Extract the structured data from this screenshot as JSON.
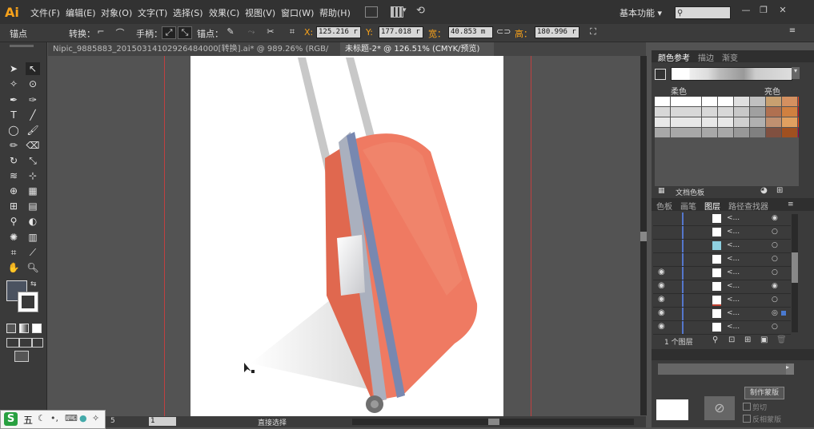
{
  "app": {
    "logo": "Ai"
  },
  "menu": [
    "文件(F)",
    "编辑(E)",
    "对象(O)",
    "文字(T)",
    "选择(S)",
    "效果(C)",
    "视图(V)",
    "窗口(W)",
    "帮助(H)"
  ],
  "workspace": {
    "label": "基本功能",
    "arrow": "▾"
  },
  "window_buttons": [
    "—",
    "❐",
    "✕"
  ],
  "control": {
    "anchor_label": "锚点",
    "convert_label": "转换：",
    "handle_label": "手柄：",
    "anchor2_label": "锚点：",
    "x_label": "X:",
    "x_value": "125.216 r",
    "y_label": "Y:",
    "y_value": "177.018 r",
    "w_label": "宽：",
    "w_value": "40.853 m",
    "h_label": "高：",
    "h_value": "180.996 r"
  },
  "tabs": [
    {
      "label": "Nipic_9885883_20150314102926484000[转换].ai* @ 989.26% (RGB/预览)",
      "close": "×"
    },
    {
      "label": "未标题-2* @ 126.51% (CMYK/预览)",
      "close": "×"
    }
  ],
  "status": {
    "zoom": "1",
    "mode": "直接选择",
    "page": "5"
  },
  "tray": {
    "s": "S",
    "wu": "五"
  },
  "color_panel": {
    "tabs": [
      "颜色参考",
      "描边",
      "渐变"
    ],
    "col1": "柔色",
    "col2": "亮色",
    "footer": "文档色板",
    "swatch_rows": [
      [
        "#ffffff",
        "#ffffff",
        "#ffffff",
        "#ffffff",
        "#e0e0e0",
        "#c0c0c0",
        "#c8a070",
        "#d49060",
        "#f04020"
      ],
      [
        "#d8d8d8",
        "#d8d8d8",
        "#d8d8d8",
        "#d8d8d8",
        "#c8c8c8",
        "#a0a0a0",
        "#b07050",
        "#d08040",
        "#d01020"
      ],
      [
        "#e8e8e8",
        "#e8e8e8",
        "#e8e8e8",
        "#e8e8e8",
        "#d0d0d0",
        "#b0b0b0",
        "#c09070",
        "#e0a060",
        "#ff4010"
      ],
      [
        "#a8a8a8",
        "#a8a8a8",
        "#a8a8a8",
        "#a8a8a8",
        "#989898",
        "#808080",
        "#805040",
        "#a05020",
        "#a00040"
      ]
    ]
  },
  "layers_panel": {
    "tabs": [
      "色板",
      "画笔",
      "图层",
      "路径查找器"
    ],
    "rows": [
      {
        "visible": false,
        "name": "<...",
        "thumb": "white"
      },
      {
        "visible": false,
        "name": "<...",
        "thumb": "white"
      },
      {
        "visible": false,
        "name": "<...",
        "thumb": "blue"
      },
      {
        "visible": false,
        "name": "<...",
        "thumb": "white"
      },
      {
        "visible": true,
        "name": "<...",
        "thumb": "white"
      },
      {
        "visible": true,
        "name": "<...",
        "thumb": "white"
      },
      {
        "visible": true,
        "name": "<...",
        "thumb": "red"
      },
      {
        "visible": true,
        "name": "<...",
        "thumb": "white"
      },
      {
        "visible": true,
        "name": "<...",
        "thumb": "white"
      }
    ],
    "footer": "1 个图层"
  },
  "transparency_panel": {
    "make_mask": "制作蒙版",
    "clip": "剪切",
    "invert": "反相蒙版"
  }
}
